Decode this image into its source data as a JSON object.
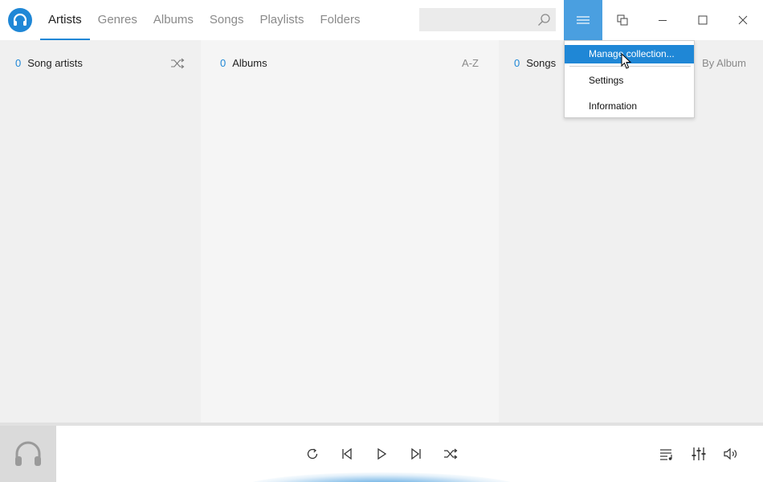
{
  "tabs": [
    "Artists",
    "Genres",
    "Albums",
    "Songs",
    "Playlists",
    "Folders"
  ],
  "active_tab": "Artists",
  "search": {
    "placeholder": "",
    "value": ""
  },
  "columns": {
    "artists": {
      "count": "0",
      "label": "Song artists"
    },
    "albums": {
      "count": "0",
      "label": "Albums",
      "sort": "A-Z"
    },
    "songs": {
      "count": "0",
      "label": "Songs",
      "sort": "By Album"
    }
  },
  "menu": {
    "items": [
      "Manage collection...",
      "Settings",
      "Information"
    ],
    "highlighted": "Manage collection..."
  },
  "colors": {
    "accent": "#1f87d6",
    "menu_button": "#4a9fe0"
  },
  "icons": [
    "app-logo-headphones-icon",
    "search-icon",
    "hamburger-menu-icon",
    "cover-player-icon",
    "minimize-icon",
    "maximize-icon",
    "close-icon",
    "shuffle-icon",
    "loop-icon",
    "previous-icon",
    "play-icon",
    "next-icon",
    "queue-icon",
    "equalizer-icon",
    "volume-icon",
    "headphones-icon"
  ]
}
